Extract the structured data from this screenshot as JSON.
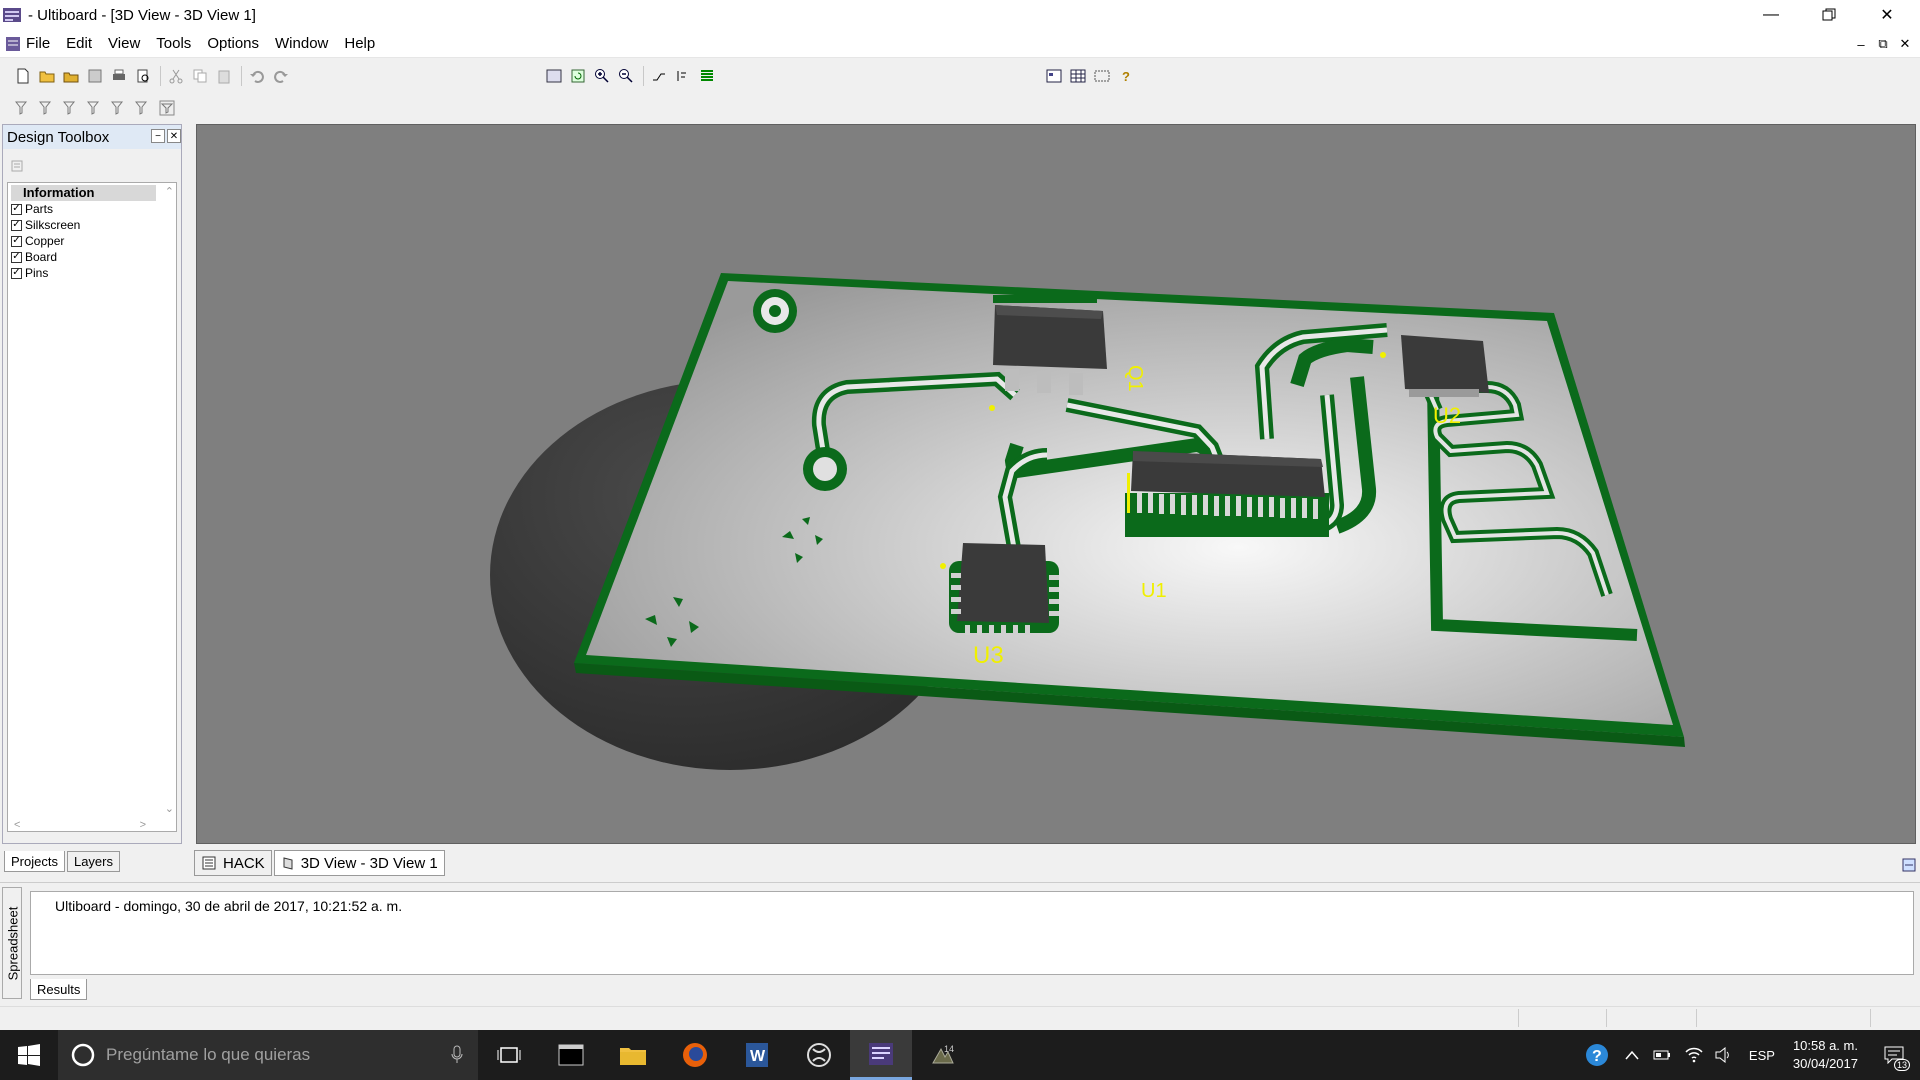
{
  "window": {
    "title": "- Ultiboard - [3D View - 3D View 1]"
  },
  "menu": [
    "File",
    "Edit",
    "View",
    "Tools",
    "Options",
    "Window",
    "Help"
  ],
  "toolbox": {
    "title": "Design Toolbox",
    "group": "Information",
    "items": [
      "Parts",
      "Silkscreen",
      "Copper",
      "Board",
      "Pins"
    ],
    "tabs": [
      "Projects",
      "Layers"
    ]
  },
  "doc_tabs": [
    "HACK",
    "3D View - 3D View 1"
  ],
  "board": {
    "labels": [
      "Q1",
      "U2",
      "U1",
      "U3"
    ],
    "colors": {
      "background": "#7f7f7f",
      "board_edge": "#0a6a1a",
      "copper": "#0b6a1b",
      "chip": "#3a3a3a",
      "silkscreen": "#f0f000"
    }
  },
  "spreadsheet": {
    "label": "Spreadsheet",
    "log": "Ultiboard  -  domingo, 30 de abril de 2017, 10:21:52 a. m.",
    "tab": "Results"
  },
  "taskbar": {
    "search_placeholder": "Pregúntame lo que quieras",
    "language": "ESP",
    "time": "10:58 a. m.",
    "date": "30/04/2017",
    "notifications": "13"
  }
}
